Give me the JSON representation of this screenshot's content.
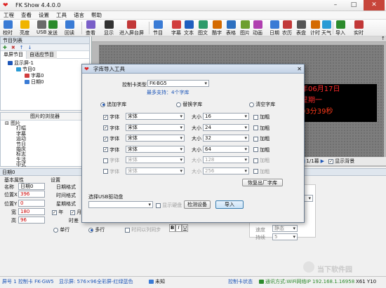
{
  "window": {
    "title": "FK Show 4.4.0.0",
    "minimize": "–",
    "maximize": "□",
    "close": "✕"
  },
  "menu": [
    "工程",
    "查看",
    "设置",
    "工具",
    "语言",
    "帮助"
  ],
  "toolbar": [
    {
      "label": "校时",
      "color": "#3a7bd5"
    },
    {
      "label": "亮度",
      "color": "#f0b400"
    },
    {
      "label": "USB",
      "color": "#6b6b6b"
    },
    {
      "label": "发送",
      "color": "#2c8b2c"
    },
    {
      "label": "回读",
      "color": "#3a7bd5"
    },
    {
      "label": "查看",
      "color": "#7a5fc8"
    },
    {
      "label": "显示",
      "color": "#333"
    },
    {
      "label": "进入屏台屏",
      "color": "#c23838"
    },
    {
      "label": "节目",
      "color": "#3a7bd5"
    },
    {
      "label": "字幕",
      "color": "#d13d3d"
    },
    {
      "label": "文本",
      "color": "#1f5fbf"
    },
    {
      "label": "图文",
      "color": "#2c9a6a"
    },
    {
      "label": "酷字",
      "color": "#d46a00"
    },
    {
      "label": "表格",
      "color": "#2c6fbf"
    },
    {
      "label": "图片",
      "color": "#6d9f2f"
    },
    {
      "label": "动画",
      "color": "#b03fb0"
    },
    {
      "label": "日期",
      "color": "#3a7bd5"
    },
    {
      "label": "农历",
      "color": "#c23838"
    },
    {
      "label": "表盘",
      "color": "#555"
    },
    {
      "label": "计时",
      "color": "#d46a00"
    },
    {
      "label": "天气",
      "color": "#2a9bd5"
    },
    {
      "label": "导入",
      "color": "#2c8b2c"
    },
    {
      "label": "实时",
      "color": "#c23838"
    }
  ],
  "program_list": {
    "header": "节目列表",
    "tabs": [
      "单屏节目",
      "自适应节目"
    ],
    "tree": [
      "显示屏-1",
      "节目0",
      "字幕0",
      "日期0"
    ]
  },
  "image_browser": {
    "header": "图片的浏览器",
    "tree": [
      "图片",
      "打幅",
      "字幕",
      "运动",
      "节日",
      "婚庆",
      "标志",
      "生活",
      "中式"
    ]
  },
  "props": {
    "header": "日期0",
    "basic": "基本属性",
    "name_label": "名称",
    "name_value": "日期0",
    "x_label": "位置X",
    "x_value": "396",
    "y_label": "位置Y",
    "y_value": "0",
    "w_label": "宽",
    "w_value": "180",
    "h_label": "高",
    "h_value": "96",
    "settings": "设置",
    "date_format_label": "日期格式",
    "time_format_label": "时间格式",
    "week_format_label": "星期格式",
    "year_chk": "年",
    "month_chk": "月",
    "time_chk": "时差",
    "single_line": "单行",
    "multi_line": "多行",
    "fixed_font": "时间以列同步"
  },
  "canvas": {
    "ruler_label": "↑",
    "page_info": "1/1幕",
    "show_bg": "显示背景",
    "led_lines": [
      "年06月17日",
      "星期一",
      "03分39秒"
    ]
  },
  "right_panel": {
    "label1": "速度",
    "label2": "持续",
    "combo1": "静态",
    "combo2": "5"
  },
  "dialog": {
    "title": "字库导入工具",
    "card_label": "控制卡类型",
    "card_value": "FK-BG5",
    "support_note": "最多支持：4个字库",
    "radios": [
      "追加字库",
      "替换字库",
      "清空字库"
    ],
    "font_label": "字体",
    "size_label": "大小",
    "bold_label": "加粗",
    "rows": [
      {
        "checked": true,
        "font": "宋体",
        "size": "16",
        "enabled": true
      },
      {
        "checked": true,
        "font": "宋体",
        "size": "24",
        "enabled": true
      },
      {
        "checked": true,
        "font": "宋体",
        "size": "32",
        "enabled": true
      },
      {
        "checked": true,
        "font": "宋体",
        "size": "64",
        "enabled": true
      },
      {
        "checked": false,
        "font": "宋体",
        "size": "128",
        "enabled": false
      },
      {
        "checked": false,
        "font": "宋体",
        "size": "256",
        "enabled": false
      }
    ],
    "restore_btn": "恢复出厂字库",
    "usb_label": "选择USB驱动盘",
    "show_disk": "显示硬盘",
    "detect_btn": "检测设备",
    "import_btn": "导入"
  },
  "status": {
    "screen": "屏号 1  控制卡 FK-GW5",
    "display": "显示屏: 576×96",
    "color": "全彩屏-红绿蓝色",
    "unknown": "未知",
    "card_status": "控制卡状态",
    "comm": "通讯方式:WiFi网络IP 192.168.1.1695858",
    "coords": "X61  Y10"
  },
  "watermark": "当下软件园"
}
